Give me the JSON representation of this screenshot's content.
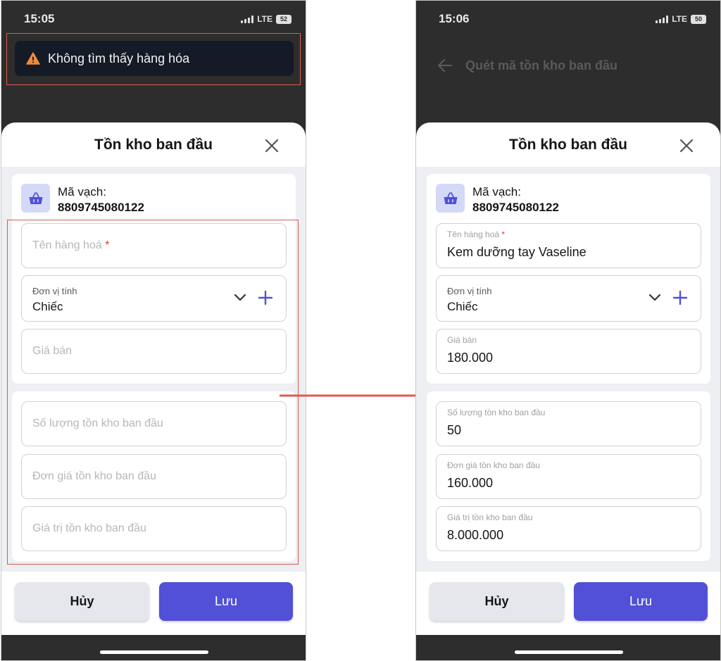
{
  "left": {
    "status": {
      "time": "15:05",
      "network": "LTE",
      "battery": "52"
    },
    "toast": {
      "text": "Không tìm thấy hàng hóa"
    },
    "sheet": {
      "title": "Tồn kho ban đầu",
      "barcode_label": "Mã vạch:",
      "barcode_value": "8809745080122",
      "name_placeholder": "Tên hàng hoá",
      "required_mark": "*",
      "unit_label": "Đơn vị tính",
      "unit_value": "Chiếc",
      "price_placeholder": "Giá bán",
      "qty_placeholder": "Số lượng tồn kho ban đầu",
      "unit_cost_placeholder": "Đơn giá tồn kho ban đầu",
      "total_placeholder": "Giá trị tồn kho ban đầu",
      "cancel_label": "Hủy",
      "save_label": "Lưu"
    }
  },
  "right": {
    "status": {
      "time": "15:06",
      "network": "LTE",
      "battery": "50"
    },
    "navbar": {
      "title": "Quét mã tồn kho ban đầu"
    },
    "sheet": {
      "title": "Tồn kho ban đầu",
      "barcode_label": "Mã vạch:",
      "barcode_value": "8809745080122",
      "name_label": "Tên hàng hoá",
      "required_mark": "*",
      "name_value": "Kem dưỡng tay Vaseline",
      "unit_label": "Đơn vị tính",
      "unit_value": "Chiếc",
      "price_label": "Giá bán",
      "price_value": "180.000",
      "qty_label": "Số lượng tồn kho ban đầu",
      "qty_value": "50",
      "unit_cost_label": "Đơn giá tồn kho ban đầu",
      "unit_cost_value": "160.000",
      "total_label": "Giá trị tồn kho ban đầu",
      "total_value": "8.000.000",
      "cancel_label": "Hủy",
      "save_label": "Lưu"
    }
  },
  "colors": {
    "accent": "#5150d6",
    "highlight_frame": "#e05a4e",
    "toast_bg": "#141a26",
    "warning": "#f08a3c"
  },
  "icons": [
    "warning-icon",
    "back-arrow-icon",
    "close-icon",
    "basket-icon",
    "chevron-down-icon",
    "plus-icon"
  ]
}
